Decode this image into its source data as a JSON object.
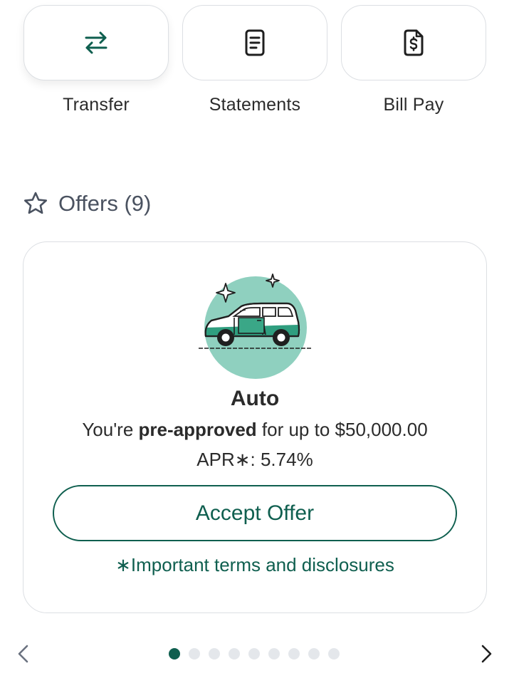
{
  "quick_actions": [
    {
      "label": "Transfer",
      "icon": "transfer-arrows-icon"
    },
    {
      "label": "Statements",
      "icon": "document-icon"
    },
    {
      "label": "Bill Pay",
      "icon": "bill-dollar-icon"
    }
  ],
  "offers": {
    "header": "Offers (9)",
    "icon": "star-outline-icon",
    "card": {
      "illustration": "car-illustration",
      "title": "Auto",
      "pre_text": "You're ",
      "bold_text": "pre-approved",
      "post_text": " for up to $50,000.00",
      "apr": "APR∗: 5.74%",
      "accept_label": "Accept Offer",
      "terms_label": "∗Important terms and disclosures"
    },
    "pager": {
      "total": 9,
      "active_index": 0
    }
  },
  "colors": {
    "accent": "#0f5f4f",
    "illustration_circle": "#8fd0bf",
    "border": "#dcdfe3",
    "dot_inactive": "#e4e7eb"
  },
  "icons": {
    "prev": "chevron-left-icon",
    "next": "chevron-right-icon"
  }
}
